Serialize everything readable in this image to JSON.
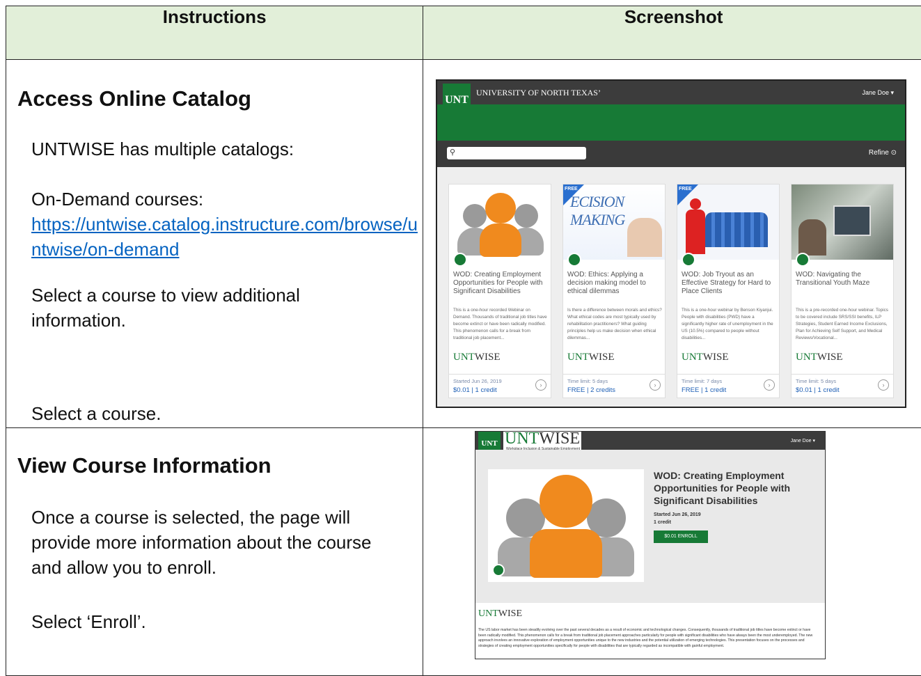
{
  "table": {
    "headers": {
      "instructions": "Instructions",
      "screenshot": "Screenshot"
    },
    "rows": [
      {
        "heading": "Access Online Catalog",
        "paragraphs": {
          "p1": "UNTWISE has multiple catalogs:",
          "p2": "On-Demand courses:",
          "link": "https://untwise.catalog.instructure.com/browse/untwise/on-demand",
          "p3": "Select a course to view additional information.",
          "p4": "Select a course."
        }
      },
      {
        "heading": "View Course Information",
        "paragraphs": {
          "p1": "Once a course is selected, the page will provide more information about the course and allow you to enroll.",
          "p2": "Select ‘Enroll’."
        }
      }
    ]
  },
  "catalog_shot": {
    "logo": "UNT",
    "university": "UNIVERSITY OF NORTH TEXAS’",
    "user": "Jane Doe ▾",
    "refine": "Refine ⊙",
    "cards": [
      {
        "free_badge": "",
        "image": "people-icon",
        "title": "WOD: Creating Employment Opportunities for People with Significant Disabilities",
        "description": "This is a one-hour recorded Webinar on Demand. Thousands of traditional job titles have become extinct or have been radically modified. This phenomenon calls for a break from traditional job placement...",
        "brand_a": "UNT",
        "brand_b": "WISE",
        "meta": "Started Jun 26, 2019",
        "price": "$0.01 | 1 credit"
      },
      {
        "free_badge": "FREE",
        "image": "decision-making-photo",
        "title": "WOD: Ethics: Applying a decision making model to ethical dilemmas",
        "description": "Is there a difference between morals and ethics? What ethical codes are most typically used by rehabilitation practitioners? What guiding principles help us make decision when ethical dilemmas...",
        "brand_a": "UNT",
        "brand_b": "WISE",
        "meta": "Time limit: 5 days",
        "price": "FREE | 2 credits"
      },
      {
        "free_badge": "FREE",
        "image": "standout-figure-photo",
        "title": "WOD: Job Tryout as an Effective Strategy for Hard to Place Clients",
        "description": "This is a one-hour webinar by Benson Kiyanjui. People with disabilities (PWD) have a significantly higher rate of unemployment in the US (10.5%) compared to people without disabilities...",
        "brand_a": "UNT",
        "brand_b": "WISE",
        "meta": "Time limit: 7 days",
        "price": "FREE | 1 credit"
      },
      {
        "free_badge": "",
        "image": "computer-lab-photo",
        "title": "WOD: Navigating the Transitional Youth Maze",
        "description": "This is a pre-recorded one-hour webinar. Topics to be covered include SRS/SSI benefits, ILP Strategies, Student Earned Income Exclusions, Plan for Achieving Self Support, and Medical Reviews/Vocational...",
        "brand_a": "UNT",
        "brand_b": "WISE",
        "meta": "Time limit: 5 days",
        "price": "$0.01 | 1 credit"
      }
    ]
  },
  "course_shot": {
    "logo": "UNT",
    "brand_a": "UNT",
    "brand_b": "WISE",
    "brand_sub": "Workplace Inclusion & Sustainable Employment",
    "user": "Jane Doe ▾",
    "title": "WOD: Creating Employment Opportunities for People with Significant Disabilities",
    "started": "Started Jun 26, 2019",
    "credit": "1 credit",
    "enroll": "$0.01 ENROLL",
    "body": "The US labor market has been steadily evolving over the past several decades as a result of economic and technological changes. Consequently, thousands of traditional job titles have become extinct or have been radically modified. This phenomenon calls for a break from traditional job placement approaches particularly for people with significant disabilities who have always been the most underemployed. The new approach involves an innovative exploration of employment opportunities unique to the new industries and the potential utilization of emerging technologies. This presentation focuses on the processes and strategies of creating employment opportunities specifically for people with disabilities that are typically regarded as incompatible with gainful employment."
  },
  "colors": {
    "header_bg": "#e2efd9",
    "unt_green": "#177a36",
    "link": "#0563c1"
  }
}
